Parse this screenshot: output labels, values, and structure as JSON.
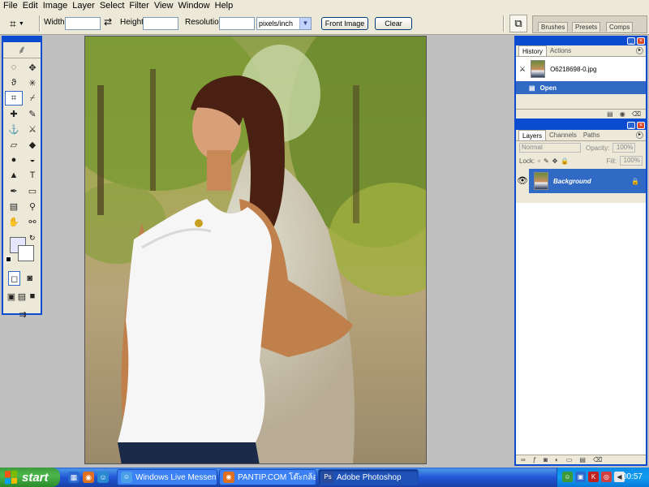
{
  "menu": [
    "File",
    "Edit",
    "Image",
    "Layer",
    "Select",
    "Filter",
    "View",
    "Window",
    "Help"
  ],
  "options": {
    "width_label": "Width:",
    "width_value": "",
    "height_label": "Height:",
    "height_value": "",
    "resolution_label": "Resolution:",
    "resolution_value": "",
    "units": "pixels/inch",
    "front_image": "Front Image",
    "clear": "Clear",
    "wells": [
      "Brushes",
      "Presets",
      "Comps"
    ]
  },
  "toolbox": {
    "tools": [
      "marquee-icon",
      "move-icon",
      "lasso-icon",
      "magic-wand-icon",
      "crop-icon",
      "slice-icon",
      "healing-brush-icon",
      "brush-icon",
      "clone-stamp-icon",
      "history-brush-icon",
      "eraser-icon",
      "paint-bucket-icon",
      "blur-icon",
      "dodge-icon",
      "path-select-icon",
      "type-icon",
      "pen-icon",
      "shape-icon",
      "notes-icon",
      "eyedropper-icon",
      "hand-icon",
      "zoom-icon"
    ],
    "tool_glyphs": [
      "◌",
      "✥",
      "ϑ",
      "✳",
      "⌗",
      "⌿",
      "✚",
      "✎",
      "⚓",
      "⚔",
      "▱",
      "◆",
      "●",
      "◒",
      "▲",
      "T",
      "✒",
      "▭",
      "▤",
      "⚲",
      "✋",
      "⚯"
    ],
    "active_tool_index": 4,
    "foreground_color": "#e6e6ff",
    "background_color": "#ffffff"
  },
  "history": {
    "tabs": [
      "History",
      "Actions"
    ],
    "snapshot": "O6218698-0.jpg",
    "state": "Open"
  },
  "layers": {
    "tabs": [
      "Layers",
      "Channels",
      "Paths"
    ],
    "blend_mode": "Normal",
    "opacity_label": "Opacity:",
    "opacity": "100%",
    "lock_label": "Lock:",
    "fill_label": "Fill:",
    "fill": "100%",
    "layer_name": "Background"
  },
  "taskbar": {
    "start": "start",
    "buttons": [
      {
        "label": "Windows Live Messen..."
      },
      {
        "label": "PANTIP.COM โต๊ะกล้อ..."
      },
      {
        "label": "Adobe Photoshop"
      }
    ],
    "clock": "00:57"
  }
}
